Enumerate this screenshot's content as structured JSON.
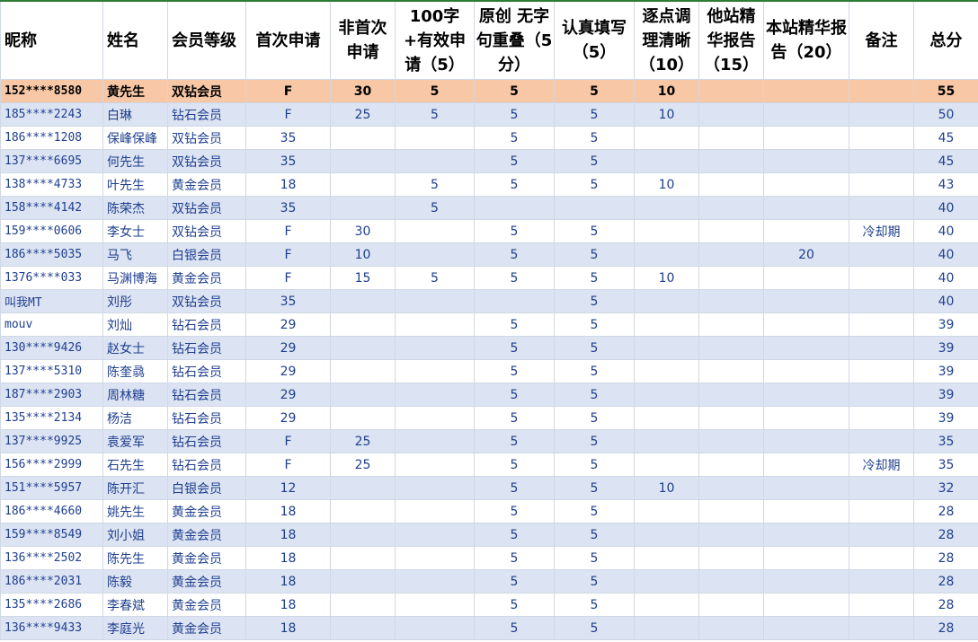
{
  "colors": {
    "header_bg": "#ffffff",
    "row_alt": "#dce3f2",
    "highlight_row": "#f7c7a6",
    "text": "#1f3f8f",
    "grid": "#d0d7e5",
    "selection_mark": "#2e7d32"
  },
  "headers": [
    "昵称",
    "姓名",
    "会员等级",
    "首次申请",
    "非首次申请",
    "100字+有效申请（5）",
    "原创 无字句重叠（5分）",
    "认真填写（5）",
    "逐点调理清晰（10）",
    "他站精华报告（15）",
    "本站精华报告（20）",
    "备注",
    "总分"
  ],
  "rows": [
    [
      "152****8580",
      "黄先生",
      "双钻会员",
      "F",
      "30",
      "5",
      "5",
      "5",
      "10",
      "",
      "",
      "",
      "55"
    ],
    [
      "185****2243",
      "白琳",
      "钻石会员",
      "F",
      "25",
      "5",
      "5",
      "5",
      "10",
      "",
      "",
      "",
      "50"
    ],
    [
      "186****1208",
      "保峰保峰",
      "双钻会员",
      "35",
      "",
      "",
      "5",
      "5",
      "",
      "",
      "",
      "",
      "45"
    ],
    [
      "137****6695",
      "何先生",
      "双钻会员",
      "35",
      "",
      "",
      "5",
      "5",
      "",
      "",
      "",
      "",
      "45"
    ],
    [
      "138****4733",
      "叶先生",
      "黄金会员",
      "18",
      "",
      "5",
      "5",
      "5",
      "10",
      "",
      "",
      "",
      "43"
    ],
    [
      "158****4142",
      "陈荣杰",
      "双钻会员",
      "35",
      "",
      "5",
      "",
      "",
      "",
      "",
      "",
      "",
      "40"
    ],
    [
      "159****0606",
      "李女士",
      "双钻会员",
      "F",
      "30",
      "",
      "5",
      "5",
      "",
      "",
      "",
      "冷却期",
      "40"
    ],
    [
      "186****5035",
      "马飞",
      "白银会员",
      "F",
      "10",
      "",
      "5",
      "5",
      "",
      "",
      "20",
      "",
      "40"
    ],
    [
      "1376****033",
      "马渊博海",
      "黄金会员",
      "F",
      "15",
      "5",
      "5",
      "5",
      "10",
      "",
      "",
      "",
      "40"
    ],
    [
      "叫我MT",
      "刘彤",
      "双钻会员",
      "35",
      "",
      "",
      "",
      "5",
      "",
      "",
      "",
      "",
      "40"
    ],
    [
      "mouv",
      "刘灿",
      "钻石会员",
      "29",
      "",
      "",
      "5",
      "5",
      "",
      "",
      "",
      "",
      "39"
    ],
    [
      "130****9426",
      "赵女士",
      "钻石会员",
      "29",
      "",
      "",
      "5",
      "5",
      "",
      "",
      "",
      "",
      "39"
    ],
    [
      "137****5310",
      "陈奎骉",
      "钻石会员",
      "29",
      "",
      "",
      "5",
      "5",
      "",
      "",
      "",
      "",
      "39"
    ],
    [
      "187****2903",
      "周林糖",
      "钻石会员",
      "29",
      "",
      "",
      "5",
      "5",
      "",
      "",
      "",
      "",
      "39"
    ],
    [
      "135****2134",
      "杨洁",
      "钻石会员",
      "29",
      "",
      "",
      "5",
      "5",
      "",
      "",
      "",
      "",
      "39"
    ],
    [
      "137****9925",
      "袁爱军",
      "钻石会员",
      "F",
      "25",
      "",
      "5",
      "5",
      "",
      "",
      "",
      "",
      "35"
    ],
    [
      "156****2999",
      "石先生",
      "钻石会员",
      "F",
      "25",
      "",
      "5",
      "5",
      "",
      "",
      "",
      "冷却期",
      "35"
    ],
    [
      "151****5957",
      "陈开汇",
      "白银会员",
      "12",
      "",
      "",
      "5",
      "5",
      "10",
      "",
      "",
      "",
      "32"
    ],
    [
      "186****4660",
      "姚先生",
      "黄金会员",
      "18",
      "",
      "",
      "5",
      "5",
      "",
      "",
      "",
      "",
      "28"
    ],
    [
      "159****8549",
      "刘小姐",
      "黄金会员",
      "18",
      "",
      "",
      "5",
      "5",
      "",
      "",
      "",
      "",
      "28"
    ],
    [
      "136****2502",
      "陈先生",
      "黄金会员",
      "18",
      "",
      "",
      "5",
      "5",
      "",
      "",
      "",
      "",
      "28"
    ],
    [
      "186****2031",
      "陈毅",
      "黄金会员",
      "18",
      "",
      "",
      "5",
      "5",
      "",
      "",
      "",
      "",
      "28"
    ],
    [
      "135****2686",
      "李春斌",
      "黄金会员",
      "18",
      "",
      "",
      "5",
      "5",
      "",
      "",
      "",
      "",
      "28"
    ],
    [
      "136****9433",
      "李庭光",
      "黄金会员",
      "18",
      "",
      "",
      "5",
      "5",
      "",
      "",
      "",
      "",
      "28"
    ]
  ]
}
